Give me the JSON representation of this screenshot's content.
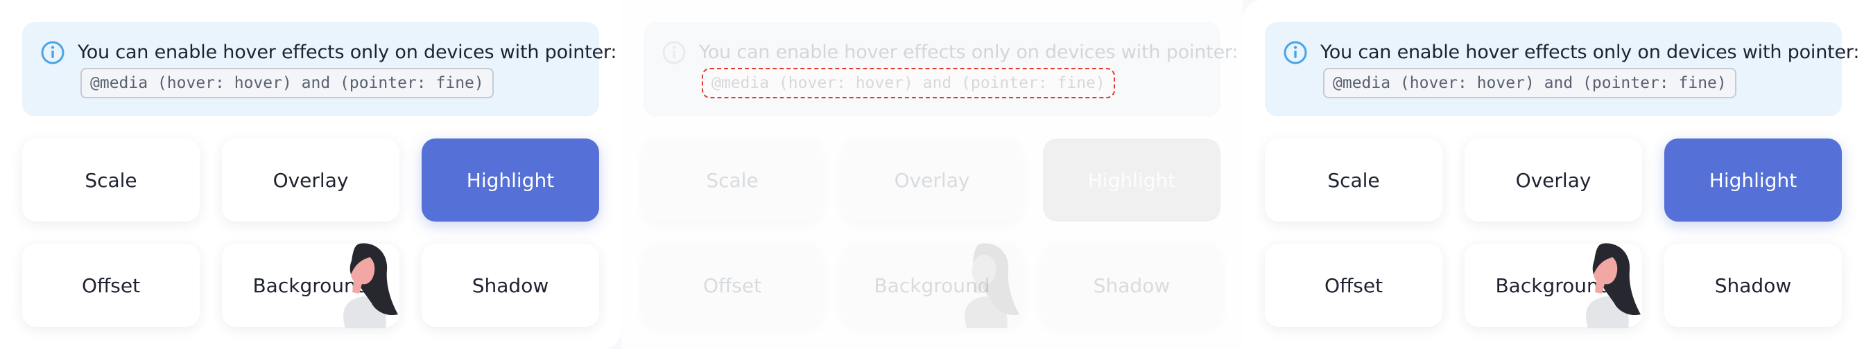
{
  "colors": {
    "accent": "#5570d6",
    "info_bg": "#eaf4fd",
    "info_icon": "#4aa3e6",
    "error_outline": "#e03a2a"
  },
  "panels": [
    {
      "state": "normal",
      "info": {
        "icon": "info-circle-icon",
        "text": "You can enable hover effects only on devices with pointer:",
        "code": "@media (hover: hover) and (pointer: fine)"
      },
      "tiles": [
        "Scale",
        "Overlay",
        "Highlight",
        "Offset",
        "Background",
        "Shadow"
      ],
      "active_tile": "Highlight"
    },
    {
      "state": "faded",
      "info": {
        "icon": "info-circle-icon",
        "text": "You can enable hover effects only on devices with pointer:",
        "code": "@media (hover: hover) and (pointer: fine)"
      },
      "tiles": [
        "Scale",
        "Overlay",
        "Highlight",
        "Offset",
        "Background",
        "Shadow"
      ],
      "active_tile": "Highlight"
    },
    {
      "state": "normal",
      "info": {
        "icon": "info-circle-icon",
        "text": "You can enable hover effects only on devices with pointer:",
        "code": "@media (hover: hover) and (pointer: fine)"
      },
      "tiles": [
        "Scale",
        "Overlay",
        "Highlight",
        "Offset",
        "Background",
        "Shadow"
      ],
      "active_tile": "Highlight"
    }
  ]
}
